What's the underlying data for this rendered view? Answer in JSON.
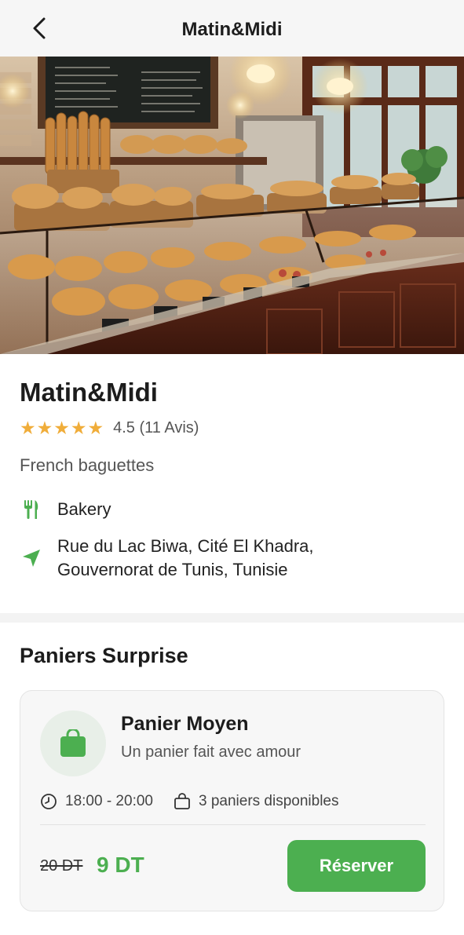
{
  "header": {
    "title": "Matin&Midi",
    "back_icon": "chevron-left-icon"
  },
  "hero": {
    "subject": "bakery display counter with baguettes, croissants and pastries"
  },
  "store": {
    "name": "Matin&Midi",
    "rating_value": 4.5,
    "rating_max": 5,
    "rating_text": "4.5 (11 Avis)",
    "description": "French baguettes",
    "category": "Bakery",
    "category_icon": "utensils-icon",
    "address_line1": "Rue du Lac Biwa, Cité El Khadra,",
    "address_line2": "Gouvernorat de Tunis, Tunisie",
    "address_icon": "location-arrow-icon",
    "star_color": "#f0ad3a",
    "accent_color": "#4caf50"
  },
  "section": {
    "title": "Paniers Surprise"
  },
  "offer": {
    "name": "Panier Moyen",
    "subtitle": "Un panier fait avec amour",
    "time_range": "18:00 - 20:00",
    "availability": "3 paniers disponibles",
    "old_price": "20 DT",
    "new_price": "9 DT",
    "reserve_label": "Réserver",
    "bag_icon": "shopping-bag-icon",
    "clock_icon": "clock-icon",
    "basket_icon": "bag-outline-icon"
  }
}
